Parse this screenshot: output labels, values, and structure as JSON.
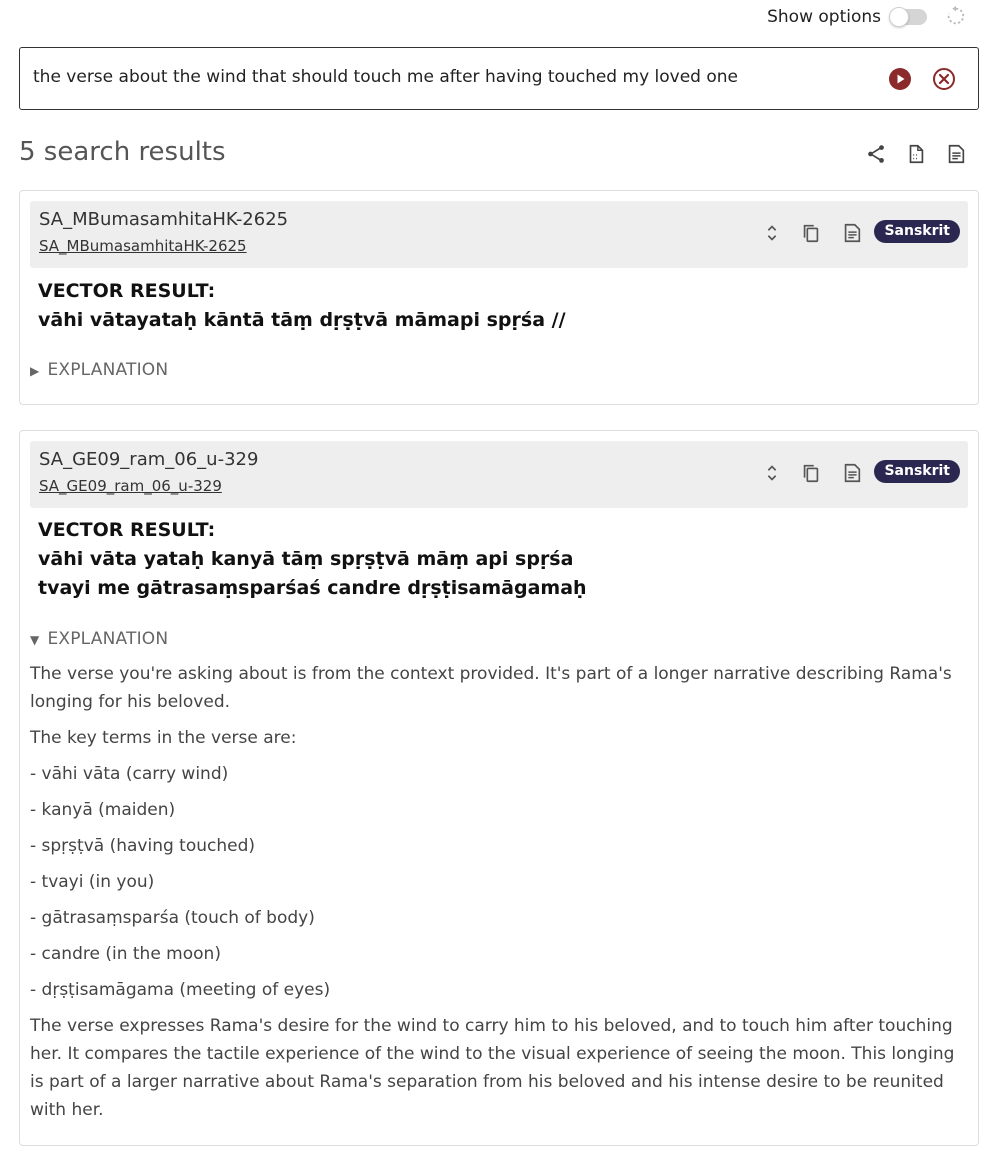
{
  "top": {
    "show_options_label": "Show options",
    "show_options_on": false
  },
  "search": {
    "query": "the verse about the wind that should touch me after having touched my loved one",
    "run_icon": "play-circle-icon",
    "clear_icon": "close-circle-icon"
  },
  "results": {
    "count_label": "5 search results",
    "actions": [
      "share-icon",
      "export-document-icon",
      "export-text-icon"
    ]
  },
  "cards": [
    {
      "id": "SA_MBumasamhitaHK-2625",
      "link": "SA_MBumasamhitaHK-2625",
      "language": "Sanskrit",
      "vector_label": "VECTOR RESULT:",
      "lines": [
        "vāhi vātayataḥ kāntā tāṃ dṛṣṭvā māmapi spṛśa //"
      ],
      "explanation_label": "EXPLANATION",
      "expanded": false
    },
    {
      "id": "SA_GE09_ram_06_u-329",
      "link": "SA_GE09_ram_06_u-329",
      "language": "Sanskrit",
      "vector_label": "VECTOR RESULT:",
      "lines": [
        "vāhi vāta yataḥ kanyā tāṃ spṛṣṭvā māṃ api spṛśa",
        "tvayi me gātrasaṃsparśaś candre dṛṣṭisamāgamaḥ"
      ],
      "explanation_label": "EXPLANATION",
      "expanded": true,
      "explanation": {
        "intro": "The verse you're asking about is from the context provided. It's part of a longer narrative describing Rama's longing for his beloved.",
        "terms_heading": "The key terms in the verse are:",
        "terms": [
          "- vāhi vāta (carry wind)",
          "- kanyā (maiden)",
          "- spṛṣṭvā (having touched)",
          "- tvayi (in you)",
          "- gātrasaṃsparśa (touch of body)",
          "- candre (in the moon)",
          "- dṛṣṭisamāgama (meeting of eyes)"
        ],
        "summary": "The verse expresses Rama's desire for the wind to carry him to his beloved, and to touch him after touching her. It compares the tactile experience of the wind to the visual experience of seeing the moon. This longing is part of a larger narrative about Rama's separation from his beloved and his intense desire to be reunited with her."
      }
    }
  ],
  "colors": {
    "accent": "#8b2a2a",
    "badge": "#2a2850",
    "header_bg": "#eeeeee"
  }
}
